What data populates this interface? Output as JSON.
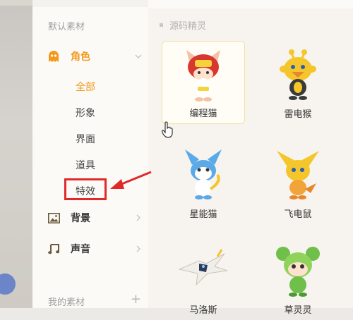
{
  "sidebar": {
    "default_section": "默认素材",
    "categories": [
      {
        "label": "角色",
        "icon": "ghost-icon"
      },
      {
        "label": "背景",
        "icon": "image-icon"
      },
      {
        "label": "声音",
        "icon": "music-note-icon"
      }
    ],
    "role_subitems": [
      "全部",
      "形象",
      "界面",
      "道具",
      "特效"
    ],
    "active_subitem": "全部",
    "highlighted_subitem": "特效",
    "my_section": "我的素材",
    "add_symbol": "+"
  },
  "main": {
    "group_title": "源码精灵",
    "sprites": [
      {
        "name": "编程猫",
        "icon": "coding-cat-sprite-icon",
        "selected": true
      },
      {
        "name": "雷电猴",
        "icon": "thunder-monkey-sprite-icon",
        "selected": false
      },
      {
        "name": "星能猫",
        "icon": "star-cat-sprite-icon",
        "selected": false
      },
      {
        "name": "飞电鼠",
        "icon": "flying-mouse-sprite-icon",
        "selected": false
      },
      {
        "name": "马洛斯",
        "icon": "malos-sprite-icon",
        "selected": false
      },
      {
        "name": "草灵灵",
        "icon": "grass-spirit-sprite-icon",
        "selected": false
      }
    ]
  },
  "colors": {
    "accent": "#f39a1c",
    "highlight": "#e02a2a"
  }
}
